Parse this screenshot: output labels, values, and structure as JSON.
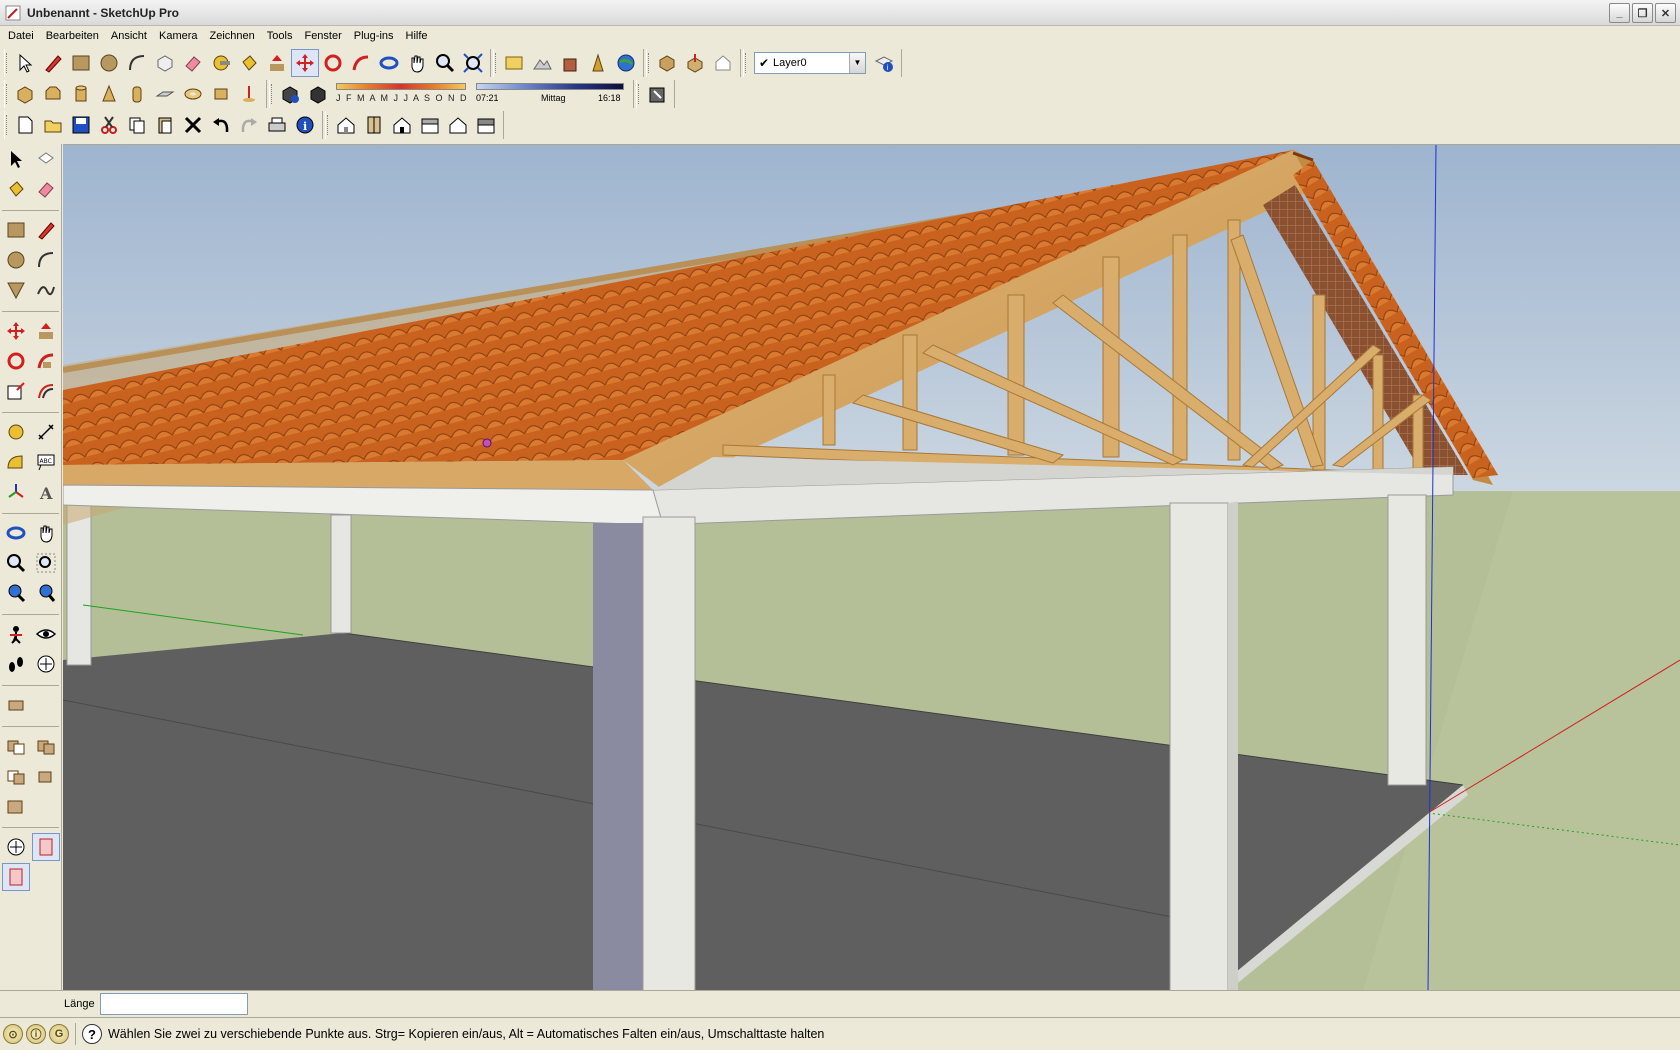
{
  "window": {
    "title": "Unbenannt - SketchUp Pro",
    "controls": [
      "minimize",
      "restore",
      "close"
    ]
  },
  "menu": {
    "items": [
      "Datei",
      "Bearbeiten",
      "Ansicht",
      "Kamera",
      "Zeichnen",
      "Tools",
      "Fenster",
      "Plug-ins",
      "Hilfe"
    ]
  },
  "toolbar": {
    "layer_name": "Layer0",
    "shadow": {
      "months": "J F M A M J J A S O N D",
      "time_start": "07:21",
      "time_mid": "Mittag",
      "time_end": "16:18"
    }
  },
  "vcb": {
    "label": "Länge",
    "value": ""
  },
  "status": {
    "message": "Wählen Sie zwei zu verschiebende Punkte aus.  Strg= Kopieren ein/aus, Alt = Automatisches Falten ein/aus, Umschalttaste halten"
  },
  "colors": {
    "sky_top": "#9eb4cf",
    "sky_bottom": "#dde4e8",
    "ground": "#b4bf98",
    "floor": "#5f5f5f",
    "roof_tile": "#c8621e",
    "timber": "#d9ad6b",
    "column": "#e8e8e3",
    "axis_red": "#d02020",
    "axis_green": "#20a020",
    "axis_blue": "#2030d0"
  }
}
